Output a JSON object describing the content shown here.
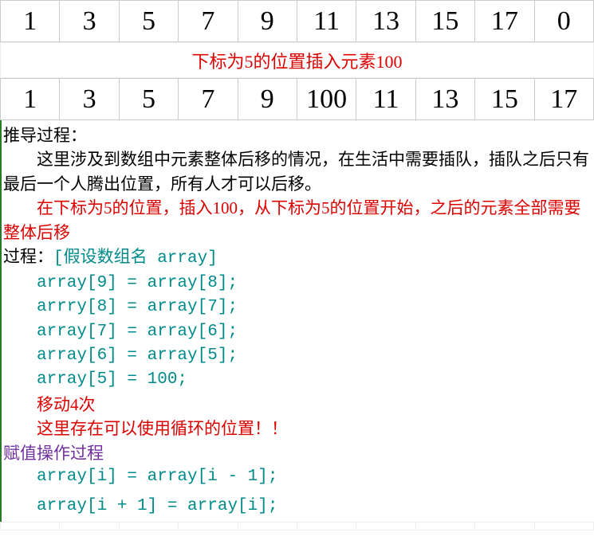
{
  "array_before": [
    "1",
    "3",
    "5",
    "7",
    "9",
    "11",
    "13",
    "15",
    "17",
    "0"
  ],
  "caption": "下标为5的位置插入元素100",
  "array_after": [
    {
      "v": "1",
      "c": ""
    },
    {
      "v": "3",
      "c": ""
    },
    {
      "v": "5",
      "c": ""
    },
    {
      "v": "7",
      "c": ""
    },
    {
      "v": "9",
      "c": ""
    },
    {
      "v": "100",
      "c": "inserted"
    },
    {
      "v": "11",
      "c": "shifted"
    },
    {
      "v": "13",
      "c": "shifted"
    },
    {
      "v": "15",
      "c": "shifted"
    },
    {
      "v": "17",
      "c": "shifted"
    }
  ],
  "title": "推导过程：",
  "p1": "这里涉及到数组中元素整体后移的情况，在生活中需要插队，插队之后只有最后一个人腾出位置，所有人才可以后移。",
  "p2": "在下标为5的位置，插入100，从下标为5的位置开始，之后的元素全部需要整体后移",
  "proc_label": "过程：",
  "proc_assume": "[假设数组名 array]",
  "code1": "array[9] = array[8];",
  "code2": "arrry[8] = array[7];",
  "code3": "array[7] = array[6];",
  "code4": "array[6] = array[5];",
  "code5": "array[5] = 100;",
  "move_note": "移动4次",
  "loop_note": "这里存在可以使用循环的位置！！",
  "assign_title": "赋值操作过程",
  "gen1": "array[i] = array[i - 1];",
  "gen2": "array[i + 1] = array[i];"
}
